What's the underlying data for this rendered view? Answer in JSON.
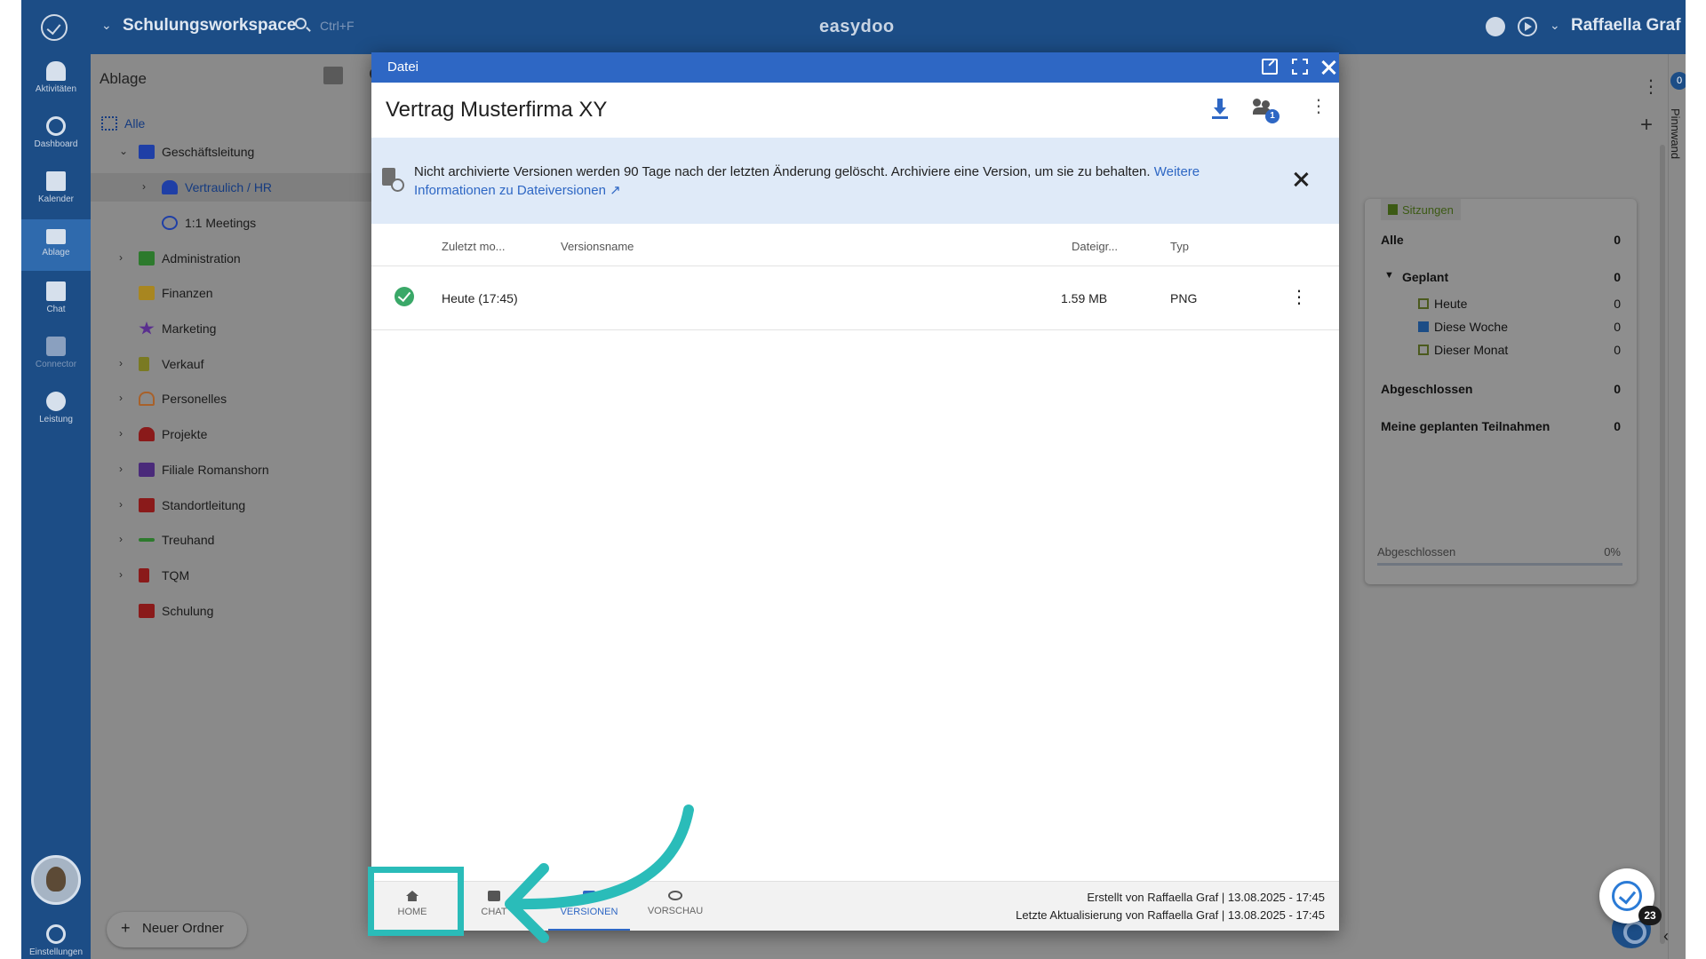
{
  "topbar": {
    "workspace": "Schulungsworkspace",
    "shortcut": "Ctrl+F",
    "app_name": "easydoo",
    "user": "Raffaella Graf"
  },
  "rail": {
    "items": [
      {
        "label": "Aktivitäten",
        "icon": "bell-icon"
      },
      {
        "label": "Dashboard",
        "icon": "gauge-icon"
      },
      {
        "label": "Kalender",
        "icon": "calendar-icon"
      },
      {
        "label": "Ablage",
        "icon": "folder-icon"
      },
      {
        "label": "Chat",
        "icon": "chat-icon"
      },
      {
        "label": "Connector",
        "icon": "connector-icon"
      },
      {
        "label": "Leistung",
        "icon": "stopwatch-icon"
      }
    ],
    "settings": "Einstellungen"
  },
  "explorer": {
    "title": "Ablage",
    "tree": [
      {
        "label": "Alle"
      },
      {
        "label": "Geschäftsleitung"
      },
      {
        "label": "Vertraulich / HR"
      },
      {
        "label": "1:1 Meetings"
      },
      {
        "label": "Administration"
      },
      {
        "label": "Finanzen"
      },
      {
        "label": "Marketing"
      },
      {
        "label": "Verkauf"
      },
      {
        "label": "Personelles"
      },
      {
        "label": "Projekte"
      },
      {
        "label": "Filiale Romanshorn"
      },
      {
        "label": "Standortleitung"
      },
      {
        "label": "Treuhand"
      },
      {
        "label": "TQM"
      },
      {
        "label": "Schulung"
      }
    ],
    "new_folder": "Neuer Ordner"
  },
  "pinnwand": {
    "label": "Pinnwand",
    "badge": "0"
  },
  "sitzungen": {
    "tag": "Sitzungen",
    "rows": [
      {
        "label": "Alle",
        "count": "0"
      },
      {
        "label": "Geplant",
        "count": "0"
      },
      {
        "label": "Heute",
        "count": "0"
      },
      {
        "label": "Diese Woche",
        "count": "0"
      },
      {
        "label": "Dieser Monat",
        "count": "0"
      },
      {
        "label": "Abgeschlossen",
        "count": "0"
      },
      {
        "label": "Meine geplanten Teilnahmen",
        "count": "0"
      }
    ],
    "progress_label": "Abgeschlossen",
    "progress_value": "0%"
  },
  "chat_badge": "23",
  "dialog": {
    "bar_title": "Datei",
    "title": "Vertrag Musterfirma XY",
    "share_badge": "1",
    "info_text": "Nicht archivierte Versionen werden 90 Tage nach der letzten Änderung gelöscht. Archiviere eine Version, um sie zu behalten.",
    "info_link": "Weitere Informationen zu Dateiversionen",
    "columns": {
      "modified": "Zuletzt mo...",
      "name": "Versionsname",
      "size": "Dateigr...",
      "type": "Typ"
    },
    "versions": [
      {
        "modified": "Heute (17:45)",
        "name": "",
        "size": "1.59 MB",
        "type": "PNG"
      }
    ],
    "tabs": [
      "HOME",
      "CHAT",
      "VERSIONEN",
      "VORSCHAU"
    ],
    "created": "Erstellt von Raffaella Graf | 13.08.2025 - 17:45",
    "updated": "Letzte Aktualisierung von Raffaella Graf | 13.08.2025 - 17:45"
  },
  "colors": {
    "brand": "#1c4d86",
    "dialog_bar": "#2e67c4",
    "annotation": "#2abcb9",
    "success": "#3aa868"
  }
}
